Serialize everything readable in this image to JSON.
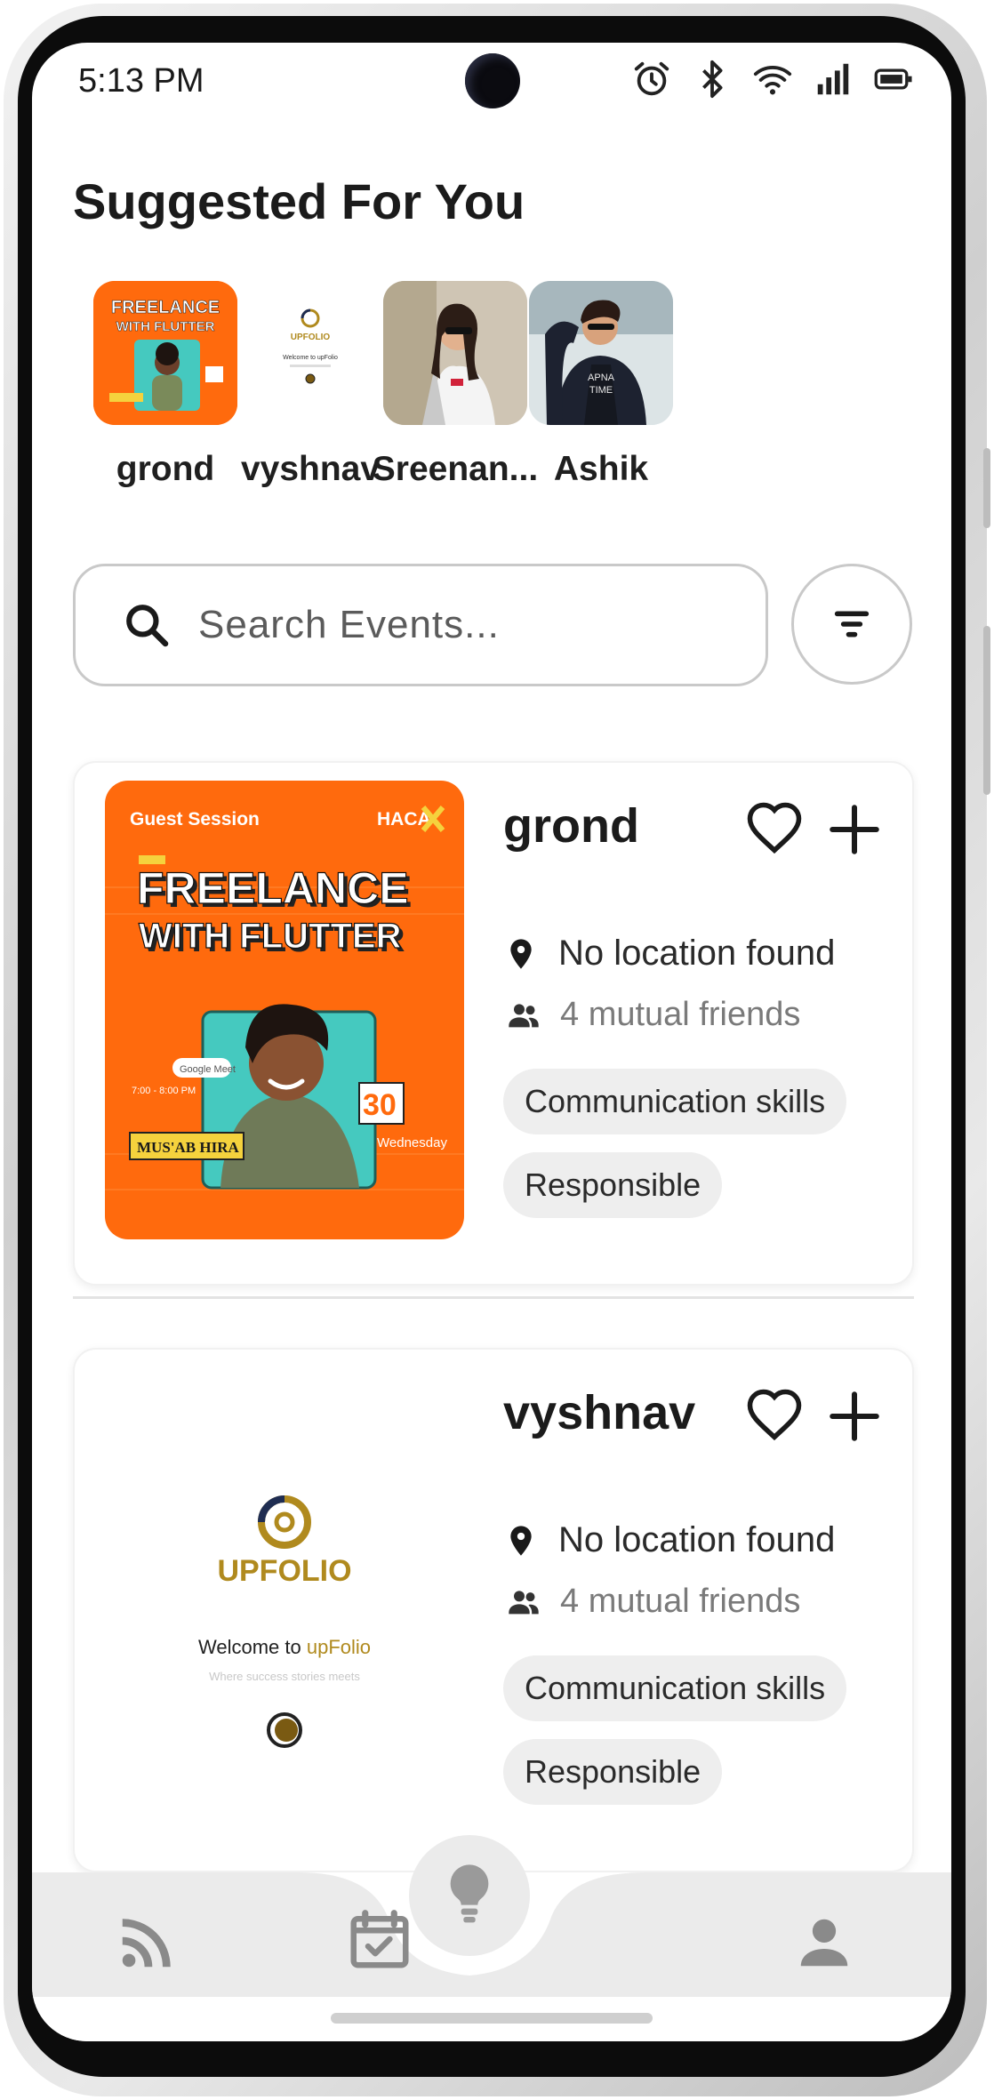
{
  "status_bar": {
    "time": "5:13 PM",
    "icons": [
      "alarm-icon",
      "bluetooth-icon",
      "wifi-icon",
      "signal-icon",
      "battery-icon"
    ]
  },
  "suggested": {
    "title": "Suggested For You",
    "items": [
      {
        "name": "grond"
      },
      {
        "name": "vyshnav"
      },
      {
        "name": "Sreenan..."
      },
      {
        "name": "Ashik"
      }
    ]
  },
  "search": {
    "placeholder": "Search Events..."
  },
  "poster": {
    "guest_session": "Guest Session",
    "brand": "HACA",
    "line1": "FREELANCE",
    "line2": "WITH FLUTTER",
    "speaker": "MUS'AB HIRA",
    "day": "30",
    "weekday": "Wednesday"
  },
  "upfolio": {
    "logo": "UPFOLIO",
    "welcome_prefix": "Welcome to ",
    "welcome_brand": "upFolio",
    "tagline": "Where success stories meets"
  },
  "events": [
    {
      "title": "grond",
      "location": "No location found",
      "friends": "4 mutual friends",
      "chips": [
        "Communication skills",
        "Responsible"
      ]
    },
    {
      "title": "vyshnav",
      "location": "No location found",
      "friends": "4 mutual friends",
      "chips": [
        "Communication skills",
        "Responsible"
      ]
    }
  ],
  "bottom_nav": {
    "items": [
      "feed-icon",
      "calendar-check-icon",
      "lightbulb-icon",
      "profile-icon"
    ],
    "active": "lightbulb-icon"
  },
  "colors": {
    "accent_orange": "#ff6a0d",
    "upfolio_gold": "#b08a1e",
    "upfolio_navy": "#1f2d52",
    "chip_bg": "#eeeeee",
    "nav_bg": "#ebebeb"
  }
}
